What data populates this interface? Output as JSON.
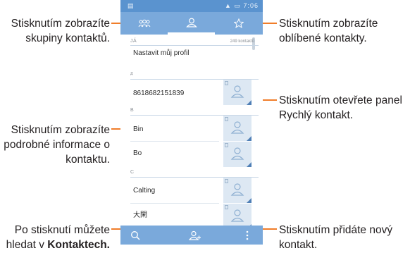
{
  "callouts": {
    "groups": "Stisknutím zobrazíte skupiny kontaktů.",
    "detail": "Stisknutím zobrazíte podrobné informace o kontaktu.",
    "search_prefix": "Po stisknutí můžete hledat v ",
    "search_bold": "Kontaktech.",
    "favorites": "Stisknutím zobrazíte oblíbené kontakty.",
    "quick_contact": "Stisknutím otevřete panel Rychlý kontakt.",
    "add_contact": "Stisknutím přidáte nový kontakt."
  },
  "phone": {
    "status_bar": {
      "time": "7:06"
    },
    "tabs": [
      {
        "icon": "groups-icon"
      },
      {
        "icon": "person-icon",
        "selected": true
      },
      {
        "icon": "star-icon"
      }
    ],
    "me_section": {
      "header": "JÁ",
      "count": "249 kontaktů",
      "profile_label": "Nastavit můj profil"
    },
    "sections": [
      {
        "letter": "#",
        "contacts": [
          "8618682151839"
        ]
      },
      {
        "letter": "B",
        "contacts": [
          "Bin",
          "Bo"
        ]
      },
      {
        "letter": "C",
        "contacts": [
          "Calting",
          "大閑"
        ]
      }
    ],
    "bottom_bar": {
      "icons": [
        "search-icon",
        "add-contact-icon",
        "more-icon"
      ]
    }
  },
  "colors": {
    "accent": "#f07d2a",
    "bar": "#7aa9db",
    "status": "#5a93cf",
    "thumb": "#dde8f3"
  }
}
